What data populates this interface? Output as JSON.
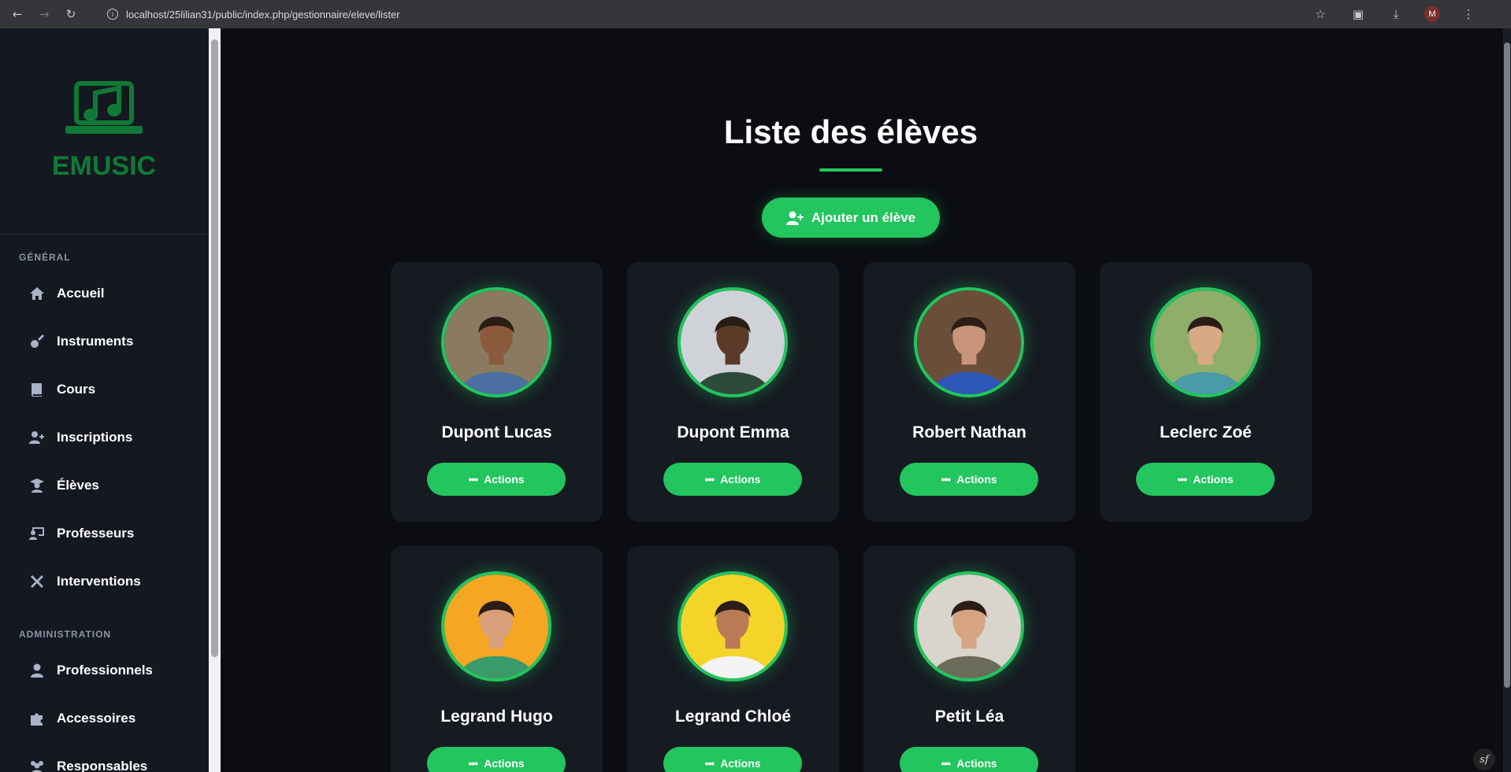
{
  "browser": {
    "url": "localhost/25lilian31/public/index.php/gestionnaire/eleve/lister",
    "profile_initial": "M"
  },
  "sidebar": {
    "logo_text": "EMUSIC",
    "sections": [
      {
        "label": "GÉNÉRAL",
        "items": [
          {
            "label": "Accueil",
            "icon": "home-icon"
          },
          {
            "label": "Instruments",
            "icon": "guitar-icon"
          },
          {
            "label": "Cours",
            "icon": "book-icon"
          },
          {
            "label": "Inscriptions",
            "icon": "user-plus-icon"
          },
          {
            "label": "Élèves",
            "icon": "graduate-icon"
          },
          {
            "label": "Professeurs",
            "icon": "teacher-icon"
          },
          {
            "label": "Interventions",
            "icon": "tools-icon"
          }
        ]
      },
      {
        "label": "ADMINISTRATION",
        "items": [
          {
            "label": "Professionnels",
            "icon": "user-tie-icon"
          },
          {
            "label": "Accessoires",
            "icon": "puzzle-icon"
          },
          {
            "label": "Responsables",
            "icon": "users-icon"
          }
        ]
      }
    ]
  },
  "main": {
    "title": "Liste des élèves",
    "add_button": "Ajouter un élève",
    "actions_label": "Actions",
    "students": [
      {
        "name": "Dupont Lucas",
        "bg": "#8a7a60",
        "skin": "#8b5a3c",
        "shirt": "#4a6fa0"
      },
      {
        "name": "Dupont Emma",
        "bg": "#cfd3d8",
        "skin": "#5b3a28",
        "shirt": "#2e4a3a"
      },
      {
        "name": "Robert Nathan",
        "bg": "#6b4e3a",
        "skin": "#c9957a",
        "shirt": "#2d58b8"
      },
      {
        "name": "Leclerc Zoé",
        "bg": "#8fae6a",
        "skin": "#d9a885",
        "shirt": "#4a9aa8"
      },
      {
        "name": "Legrand Hugo",
        "bg": "#f5a623",
        "skin": "#d8a07a",
        "shirt": "#3a9a6a"
      },
      {
        "name": "Legrand Chloé",
        "bg": "#f5d42a",
        "skin": "#b97a55",
        "shirt": "#f4f4f4"
      },
      {
        "name": "Petit Léa",
        "bg": "#d9d4cc",
        "skin": "#d6a482",
        "shirt": "#6b6b5a"
      }
    ]
  },
  "colors": {
    "accent": "#22c55e",
    "logo": "#0f7a37",
    "background": "#0b0d12",
    "card": "#161a21",
    "sidebar": "#141820"
  }
}
